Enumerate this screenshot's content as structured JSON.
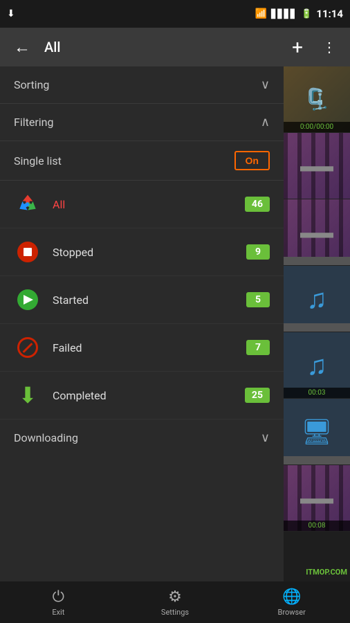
{
  "statusBar": {
    "time": "11:14",
    "icons": [
      "download-icon",
      "wifi-icon",
      "signal-icon",
      "battery-icon"
    ]
  },
  "toolbar": {
    "backLabel": "←",
    "title": "All",
    "addLabel": "+",
    "moreLabel": "⋮"
  },
  "sorting": {
    "label": "Sorting",
    "chevron": "∨"
  },
  "filtering": {
    "label": "Filtering",
    "chevron": "∧"
  },
  "singleList": {
    "label": "Single list",
    "toggleLabel": "On"
  },
  "filterItems": [
    {
      "id": "all",
      "name": "All",
      "count": 46,
      "active": true
    },
    {
      "id": "stopped",
      "name": "Stopped",
      "count": 9,
      "active": false
    },
    {
      "id": "started",
      "name": "Started",
      "count": 5,
      "active": false
    },
    {
      "id": "failed",
      "name": "Failed",
      "count": 7,
      "active": false
    },
    {
      "id": "completed",
      "name": "Completed",
      "count": 25,
      "active": false
    }
  ],
  "downloading": {
    "label": "Downloading",
    "chevron": "∨"
  },
  "bottomNav": [
    {
      "id": "exit",
      "label": "Exit",
      "icon": "⏻"
    },
    {
      "id": "settings",
      "label": "Settings",
      "icon": "⚙"
    },
    {
      "id": "browser",
      "label": "Browser",
      "icon": "🌐"
    }
  ],
  "thumbs": [
    {
      "type": "archive",
      "overlay": "0:00/00:00"
    },
    {
      "type": "film-purple",
      "overlay": ""
    },
    {
      "type": "film-purple",
      "overlay": ""
    },
    {
      "type": "music",
      "overlay": ""
    },
    {
      "type": "music",
      "overlay": "00:03"
    },
    {
      "type": "computer",
      "overlay": ""
    },
    {
      "type": "film-purple",
      "overlay": "00:08"
    }
  ],
  "watermark": "ITMOP.COM",
  "colors": {
    "accent": "#6abf3a",
    "red": "#cc2200",
    "activeText": "#ff4444",
    "toggleColor": "#ff6600"
  }
}
